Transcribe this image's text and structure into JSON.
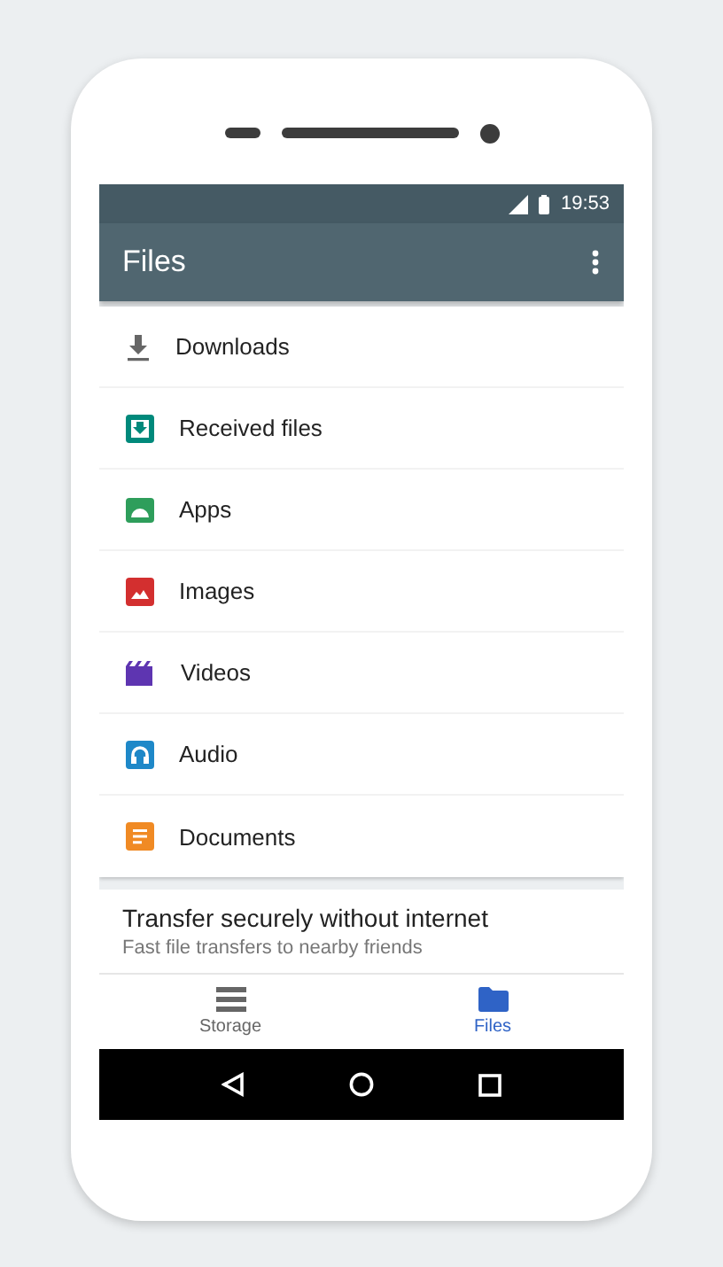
{
  "status_bar": {
    "time": "19:53"
  },
  "app_bar": {
    "title": "Files"
  },
  "categories": [
    {
      "label": "Downloads"
    },
    {
      "label": "Received files"
    },
    {
      "label": "Apps"
    },
    {
      "label": "Images"
    },
    {
      "label": "Videos"
    },
    {
      "label": "Audio"
    },
    {
      "label": "Documents"
    }
  ],
  "promo_card": {
    "title": "Transfer securely without internet",
    "subtitle": "Fast file transfers to nearby friends"
  },
  "bottom_nav": [
    {
      "label": "Storage",
      "selected": false
    },
    {
      "label": "Files",
      "selected": true
    }
  ]
}
